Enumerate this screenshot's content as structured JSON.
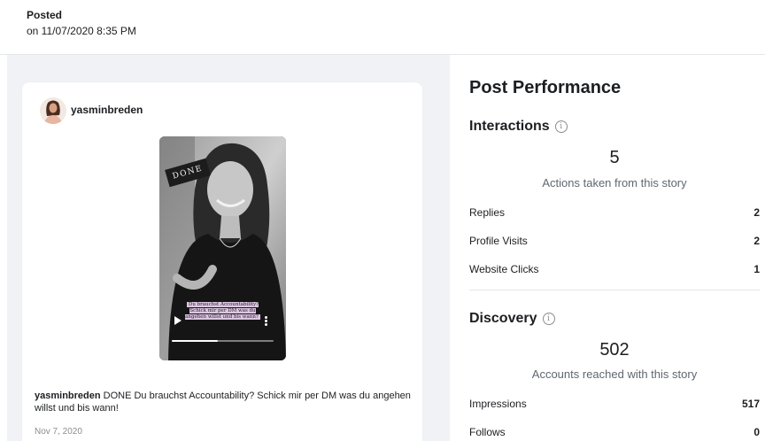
{
  "header": {
    "posted_label": "Posted",
    "posted_date": "on 11/07/2020 8:35 PM"
  },
  "post": {
    "username": "yasminbreden",
    "story_tag": "DONE",
    "story_caption": "Du brauchst Accountability? Schick mir per DM was du angehen willst und bis wann?",
    "story_progress": 0.45,
    "caption_username": "yasminbreden",
    "caption_text": " DONE Du brauchst Accountability? Schick mir per DM was du angehen willst und bis wann!",
    "date": "Nov 7, 2020"
  },
  "performance": {
    "title": "Post Performance",
    "interactions": {
      "title": "Interactions",
      "total": "5",
      "subtitle": "Actions taken from this story",
      "rows": [
        {
          "label": "Replies",
          "value": "2"
        },
        {
          "label": "Profile Visits",
          "value": "2"
        },
        {
          "label": "Website Clicks",
          "value": "1"
        }
      ]
    },
    "discovery": {
      "title": "Discovery",
      "total": "502",
      "subtitle": "Accounts reached with this story",
      "rows": [
        {
          "label": "Impressions",
          "value": "517"
        },
        {
          "label": "Follows",
          "value": "0"
        }
      ]
    }
  },
  "icons": {
    "info": "info-icon",
    "play": "play-icon",
    "more": "more-vertical-icon"
  },
  "colors": {
    "background": "#f0f2f5",
    "text": "#1c1e21",
    "muted": "#606770",
    "story_caption_bg": "#dcc6e2"
  }
}
